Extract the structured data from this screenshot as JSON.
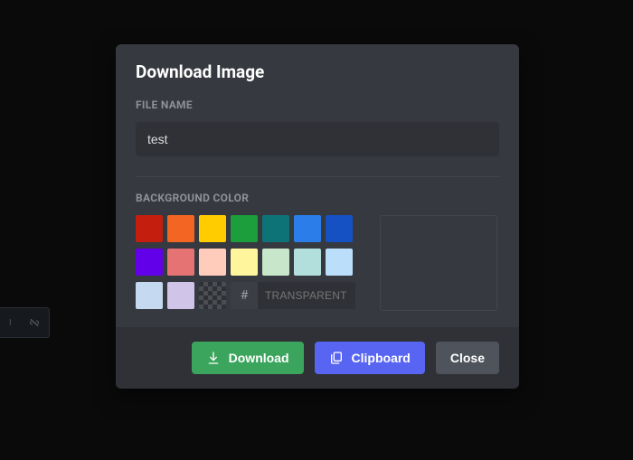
{
  "modal": {
    "title": "Download Image",
    "filename_label": "FILE NAME",
    "filename_value": "test",
    "bgcolor_label": "BACKGROUND COLOR",
    "hex_prefix": "#",
    "hex_placeholder": "TRANSPARENT",
    "swatches": [
      "#c41e0e",
      "#f26522",
      "#ffcc00",
      "#1b9e3b",
      "#0d7377",
      "#2b7de9",
      "#1551c2",
      "#6200ea",
      "#e57373",
      "#ffccbc",
      "#fff59d",
      "#c8e6c9",
      "#b2dfdb",
      "#bbdefb",
      "#c5d9f1",
      "#d1c4e9"
    ],
    "buttons": {
      "download": "Download",
      "clipboard": "Clipboard",
      "close": "Close"
    }
  },
  "colors": {
    "green": "#3ba55d",
    "blurple": "#5865f2",
    "grey": "#4f545c"
  }
}
